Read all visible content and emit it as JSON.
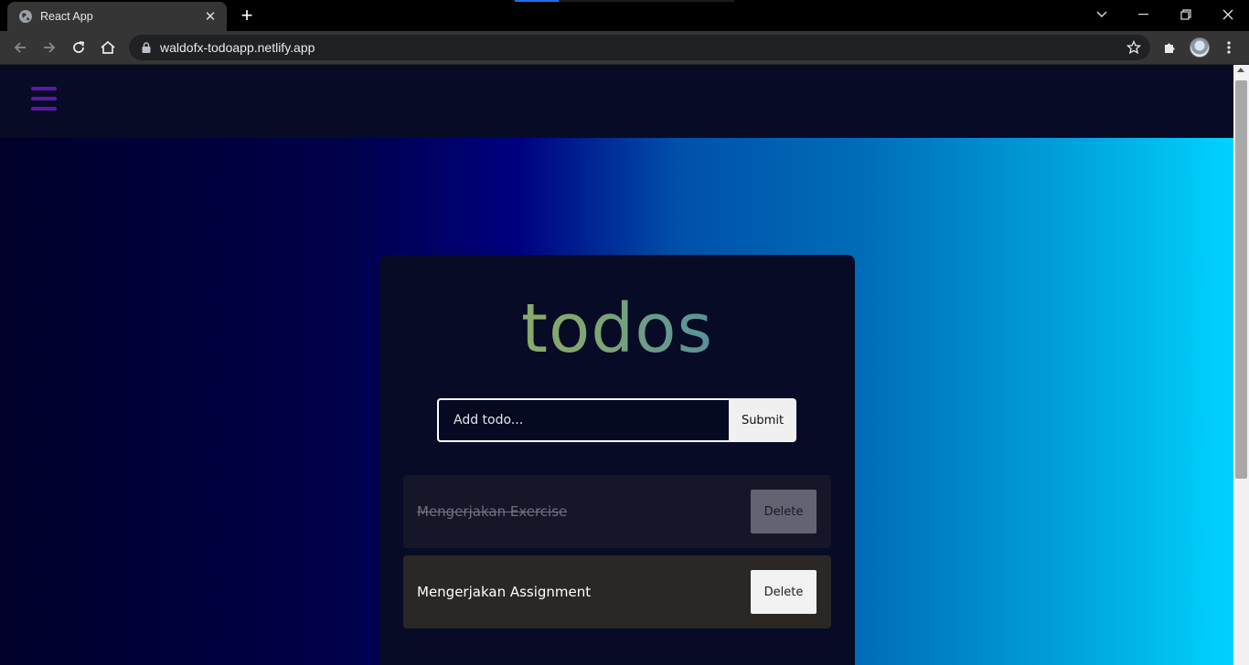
{
  "browser": {
    "tab": {
      "title": "React App",
      "close": "✕"
    },
    "new_tab": "+",
    "window_controls": {
      "minimize": "—",
      "restore": "❐",
      "close": "✕"
    },
    "url": "waldofx-todoapp.netlify.app"
  },
  "app": {
    "logo": "todos",
    "input": {
      "placeholder": "Add todo..."
    },
    "submit_label": "Submit",
    "todos": [
      {
        "text": "Mengerjakan Exercise",
        "completed": true,
        "delete_label": "Delete"
      },
      {
        "text": "Mengerjakan Assignment",
        "completed": false,
        "delete_label": "Delete"
      }
    ]
  },
  "colors": {
    "accent": "#5b1aa3",
    "card": "#070b26",
    "gradient_start": "#00002a",
    "gradient_end": "#00d3ff"
  }
}
